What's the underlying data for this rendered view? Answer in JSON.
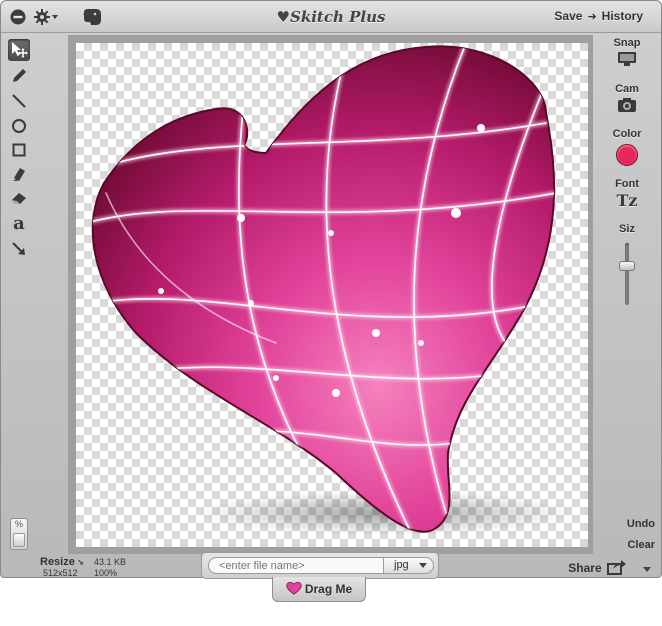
{
  "window": {
    "title": "♥Skitch Plus"
  },
  "titlebar": {
    "save_label": "Save",
    "history_label": "History",
    "icons": [
      "minus-circle-icon",
      "gear-icon",
      "elephant-icon"
    ]
  },
  "left_tools": [
    {
      "name": "select-move-tool",
      "icon": "arrow-move-icon",
      "selected": true
    },
    {
      "name": "pencil-tool",
      "icon": "pencil-icon"
    },
    {
      "name": "line-tool",
      "icon": "line-icon"
    },
    {
      "name": "ellipse-tool",
      "icon": "circle-icon"
    },
    {
      "name": "rectangle-tool",
      "icon": "square-icon"
    },
    {
      "name": "highlighter-tool",
      "icon": "highlighter-icon"
    },
    {
      "name": "eraser-tool",
      "icon": "eraser-icon"
    },
    {
      "name": "text-tool",
      "icon": "letter-a-icon",
      "glyph": "a"
    },
    {
      "name": "arrow-tool",
      "icon": "arrow-icon"
    }
  ],
  "zoom_slider": {
    "label": "%"
  },
  "right_panel": {
    "snap_label": "Snap",
    "cam_label": "Cam",
    "color_label": "Color",
    "color_value": "#e8285c",
    "font_label": "Font",
    "font_icon_text": "Tz",
    "size_label": "Siz",
    "undo_label": "Undo",
    "clear_label": "Clear"
  },
  "statusbar": {
    "resize_label": "Resize",
    "dimensions": "512x512",
    "file_size": "43.1 KB",
    "zoom": "100%",
    "filename_placeholder": "<enter file name>",
    "format": "jpg",
    "share_label": "Share",
    "drag_label": "Drag Me"
  },
  "colors": {
    "accent": "#e8285c",
    "heart_dark": "#7d0f3a",
    "heart_light": "#f06aa8"
  }
}
